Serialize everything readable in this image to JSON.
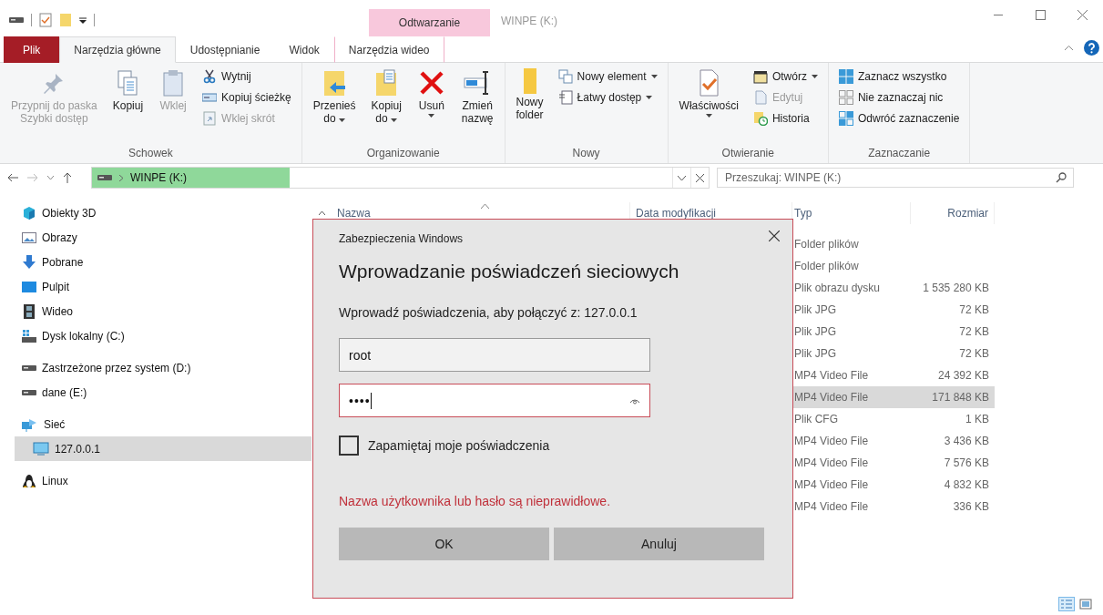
{
  "contextual_tab_header": {
    "label": "Odtwarzanie"
  },
  "window": {
    "title": "WINPE (K:)"
  },
  "ribbon_tabs": [
    {
      "label": "Plik",
      "kind": "file",
      "selected": false
    },
    {
      "label": "Narzędzia główne",
      "kind": "tab",
      "selected": true
    },
    {
      "label": "Udostępnianie",
      "kind": "tab",
      "selected": false
    },
    {
      "label": "Widok",
      "kind": "tab",
      "selected": false
    },
    {
      "label": "Narzędzia wideo",
      "kind": "contextual",
      "selected": false
    }
  ],
  "ribbon_groups": [
    {
      "name": "Schowek",
      "commands": [
        {
          "kind": "large",
          "label": "Przypnij do paska\nSzybki dostęp",
          "disabled": true,
          "dropdown": false
        },
        {
          "kind": "large",
          "label": "Kopiuj",
          "disabled": false,
          "dropdown": false
        },
        {
          "kind": "large",
          "label": "Wklej",
          "disabled": true,
          "dropdown": false
        },
        {
          "kind": "small",
          "label": "Wytnij",
          "disabled": false,
          "dropdown": false
        },
        {
          "kind": "small",
          "label": "Kopiuj ścieżkę",
          "disabled": false,
          "dropdown": false
        },
        {
          "kind": "small",
          "label": "Wklej skrót",
          "disabled": true,
          "dropdown": false
        }
      ]
    },
    {
      "name": "Organizowanie",
      "commands": [
        {
          "kind": "large",
          "label": "Przenieś\ndo",
          "disabled": false,
          "dropdown": true
        },
        {
          "kind": "large",
          "label": "Kopiuj\ndo",
          "disabled": false,
          "dropdown": true
        },
        {
          "kind": "large",
          "label": "Usuń",
          "disabled": false,
          "dropdown": true
        },
        {
          "kind": "large",
          "label": "Zmień\nnazwę",
          "disabled": false,
          "dropdown": false
        }
      ]
    },
    {
      "name": "Nowy",
      "commands": [
        {
          "kind": "large",
          "label": "Nowy\nfolder",
          "disabled": false,
          "dropdown": false
        },
        {
          "kind": "small",
          "label": "Nowy element",
          "disabled": false,
          "dropdown": true
        },
        {
          "kind": "small",
          "label": "Łatwy dostęp",
          "disabled": false,
          "dropdown": true
        }
      ]
    },
    {
      "name": "Otwieranie",
      "commands": [
        {
          "kind": "large",
          "label": "Właściwości",
          "disabled": false,
          "dropdown": true
        },
        {
          "kind": "small",
          "label": "Otwórz",
          "disabled": false,
          "dropdown": true
        },
        {
          "kind": "small",
          "label": "Edytuj",
          "disabled": true,
          "dropdown": false
        },
        {
          "kind": "small",
          "label": "Historia",
          "disabled": false,
          "dropdown": false
        }
      ]
    },
    {
      "name": "Zaznaczanie",
      "commands": [
        {
          "kind": "small",
          "label": "Zaznacz wszystko",
          "disabled": false,
          "dropdown": false
        },
        {
          "kind": "small",
          "label": "Nie zaznaczaj nic",
          "disabled": false,
          "dropdown": false
        },
        {
          "kind": "small",
          "label": "Odwróć zaznaczenie",
          "disabled": false,
          "dropdown": false
        }
      ]
    }
  ],
  "address_bar": {
    "path": [
      "WINPE (K:)"
    ],
    "level": 0.32
  },
  "search": {
    "placeholder": "Przeszukaj: WINPE (K:)"
  },
  "sidebar": {
    "items": [
      {
        "label": "Obiekty 3D",
        "selected": false
      },
      {
        "label": "Obrazy",
        "selected": false
      },
      {
        "label": "Pobrane",
        "selected": false
      },
      {
        "label": "Pulpit",
        "selected": false
      },
      {
        "label": "Wideo",
        "selected": false
      },
      {
        "label": "Dysk lokalny (C:)",
        "selected": false
      },
      {
        "label": "Zastrzeżone przez system (D:)",
        "selected": false
      },
      {
        "label": "dane (E:)",
        "selected": false
      },
      {
        "label": "Sieć",
        "selected": false,
        "children": [
          {
            "label": "127.0.0.1",
            "selected": true
          }
        ]
      },
      {
        "label": "Linux",
        "selected": false
      }
    ]
  },
  "table": {
    "columns": [
      {
        "label": "Nazwa",
        "sorted": true
      },
      {
        "label": "Data modyfikacji",
        "sorted": false
      },
      {
        "label": "Typ",
        "sorted": false
      },
      {
        "label": "Rozmiar",
        "sorted": false
      }
    ],
    "rows": [
      {
        "type": "Folder plików",
        "selected": false
      },
      {
        "type": "Folder plików",
        "selected": false
      },
      {
        "type": "Plik obrazu dysku",
        "size": "1 535 280 KB",
        "selected": false
      },
      {
        "type": "Plik JPG",
        "size": "72 KB",
        "selected": false
      },
      {
        "type": "Plik JPG",
        "size": "72 KB",
        "selected": false
      },
      {
        "type": "Plik JPG",
        "size": "72 KB",
        "selected": false
      },
      {
        "type": "MP4 Video File",
        "size": "24 392 KB",
        "selected": false
      },
      {
        "type": "MP4 Video File",
        "size": "171 848 KB",
        "selected": true
      },
      {
        "type": "Plik CFG",
        "size": "1 KB",
        "selected": false
      },
      {
        "type": "MP4 Video File",
        "size": "3 436 KB",
        "selected": false
      },
      {
        "type": "MP4 Video File",
        "size": "7 576 KB",
        "selected": false
      },
      {
        "type": "MP4 Video File",
        "size": "4 832 KB",
        "selected": false
      },
      {
        "type": "MP4 Video File",
        "size": "336 KB",
        "selected": false
      }
    ]
  },
  "dialog": {
    "app": "Zabezpieczenia Windows",
    "title": "Wprowadzanie poświadczeń sieciowych",
    "message": "Wprowadź poświadczenia, aby połączyć z: 127.0.0.1",
    "username": {
      "value": "root"
    },
    "password": {
      "value": "••••"
    },
    "remember": {
      "label": "Zapamiętaj moje poświadczenia",
      "checked": false
    },
    "error": "Nazwa użytkownika lub hasło są nieprawidłowe.",
    "buttons": [
      "OK",
      "Anuluj"
    ]
  }
}
